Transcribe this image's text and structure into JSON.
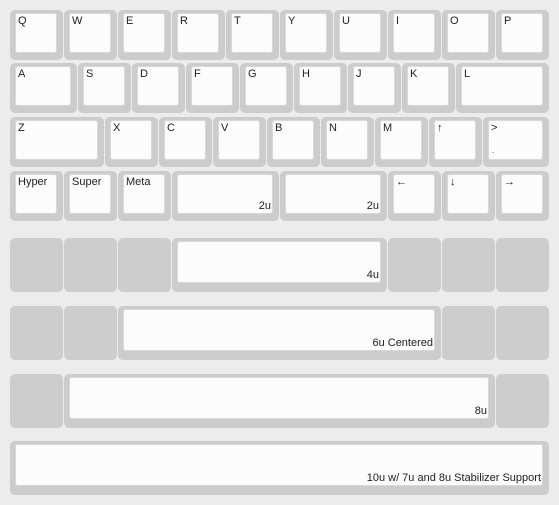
{
  "rows": {
    "row1": [
      "Q",
      "W",
      "E",
      "R",
      "T",
      "Y",
      "U",
      "I",
      "O",
      "P"
    ],
    "row2": [
      "A",
      "S",
      "D",
      "F",
      "G",
      "H",
      "J",
      "K",
      "L"
    ],
    "row3": [
      "Z",
      "X",
      "C",
      "V",
      "B",
      "N",
      "M",
      "↑",
      ">",
      "."
    ],
    "row4": [
      "Hyper",
      "Super",
      "Meta",
      "2u",
      "2u",
      "←",
      "↓",
      "→"
    ]
  },
  "sizes": {
    "four": "4u",
    "six": "6u Centered",
    "eight": "8u",
    "ten": "10u w/ 7u and 8u Stabilizer Support"
  },
  "colors": {
    "frame": "#ececec",
    "key_base": "#cccccc",
    "key_cap": "#fcfcfc"
  }
}
